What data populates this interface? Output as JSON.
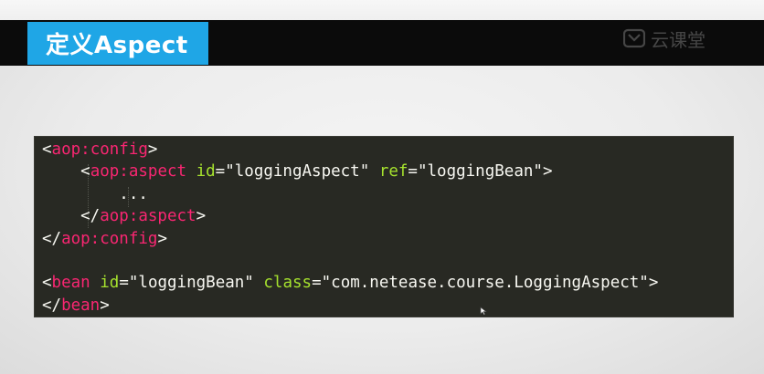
{
  "slide": {
    "title": "定义Aspect",
    "watermark_text": "云课堂",
    "watermark_icon": "netease-logo-icon",
    "colors": {
      "title_bg": "#1fa6e6",
      "header_bar": "#0b0b0b",
      "code_bg": "#282923",
      "tag": "#f92672",
      "attribute": "#a6e22e",
      "text": "#f8f8f2"
    }
  },
  "code": {
    "language": "xml",
    "lines": [
      [
        {
          "t": "punct",
          "v": "<"
        },
        {
          "t": "tag",
          "v": "aop:config"
        },
        {
          "t": "punct",
          "v": ">"
        }
      ],
      [
        {
          "t": "punct",
          "v": "    <"
        },
        {
          "t": "tag",
          "v": "aop:aspect"
        },
        {
          "t": "punct",
          "v": " "
        },
        {
          "t": "attr",
          "v": "id"
        },
        {
          "t": "punct",
          "v": "="
        },
        {
          "t": "val",
          "v": "\"loggingAspect\""
        },
        {
          "t": "punct",
          "v": " "
        },
        {
          "t": "attr",
          "v": "ref"
        },
        {
          "t": "punct",
          "v": "="
        },
        {
          "t": "val",
          "v": "\"loggingBean\""
        },
        {
          "t": "punct",
          "v": ">"
        }
      ],
      [
        {
          "t": "dots",
          "v": "        ..."
        }
      ],
      [
        {
          "t": "punct",
          "v": "    </"
        },
        {
          "t": "tag",
          "v": "aop:aspect"
        },
        {
          "t": "punct",
          "v": ">"
        }
      ],
      [
        {
          "t": "punct",
          "v": "</"
        },
        {
          "t": "tag",
          "v": "aop:config"
        },
        {
          "t": "punct",
          "v": ">"
        }
      ],
      [],
      [
        {
          "t": "punct",
          "v": "<"
        },
        {
          "t": "tag",
          "v": "bean"
        },
        {
          "t": "punct",
          "v": " "
        },
        {
          "t": "attr",
          "v": "id"
        },
        {
          "t": "punct",
          "v": "="
        },
        {
          "t": "val",
          "v": "\"loggingBean\""
        },
        {
          "t": "punct",
          "v": " "
        },
        {
          "t": "attr",
          "v": "class"
        },
        {
          "t": "punct",
          "v": "="
        },
        {
          "t": "val",
          "v": "\"com.netease.course.LoggingAspect\""
        },
        {
          "t": "punct",
          "v": ">"
        }
      ],
      [
        {
          "t": "punct",
          "v": "</"
        },
        {
          "t": "tag",
          "v": "bean"
        },
        {
          "t": "punct",
          "v": ">"
        }
      ]
    ]
  },
  "pointer": {
    "icon": "mouse-pointer-icon"
  }
}
